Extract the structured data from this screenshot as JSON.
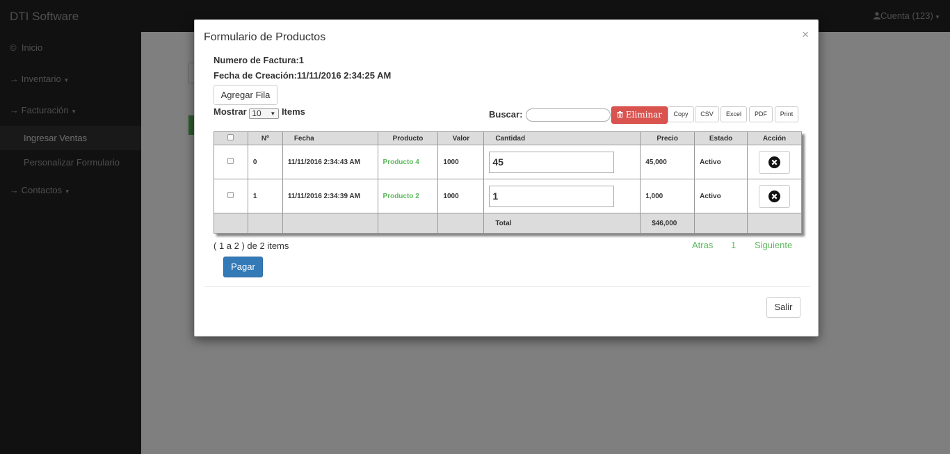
{
  "navbar": {
    "brand": "DTI Software",
    "account": "Cuenta (123)"
  },
  "sidebar": {
    "items": [
      {
        "label": "Inicio"
      },
      {
        "label": "Inventario"
      },
      {
        "label": "Facturación"
      },
      {
        "label": "Ingresar Ventas"
      },
      {
        "label": "Personalizar Formulario"
      },
      {
        "label": "Contactos"
      }
    ]
  },
  "modal": {
    "title": "Formulario de Productos",
    "close": "×",
    "invoice": "Numero de Factura:1",
    "created": "Fecha de Creación:11/11/2016 2:34:25 AM",
    "add_row": "Agregar Fila",
    "show_label": "Mostrar",
    "show_value": "10",
    "items_label": "Items",
    "search_label": "Buscar:",
    "search_value": "",
    "delete_label": "Eliminar",
    "export_buttons": [
      "Copy",
      "CSV",
      "Excel",
      "PDF",
      "Print"
    ],
    "columns": [
      "Nº",
      "Fecha",
      "Producto",
      "Valor",
      "Cantidad",
      "Precio",
      "Estado",
      "Acción"
    ],
    "rows": [
      {
        "n": "0",
        "fecha": "11/11/2016 2:34:43 AM",
        "producto": "Producto 4",
        "valor": "1000",
        "cantidad": "45",
        "precio": "45,000",
        "estado": "Activo"
      },
      {
        "n": "1",
        "fecha": "11/11/2016 2:34:39 AM",
        "producto": "Producto 2",
        "valor": "1000",
        "cantidad": "1",
        "precio": "1,000",
        "estado": "Activo"
      }
    ],
    "total_label": "Total",
    "total_value": "$46,000",
    "pagination_info": "( 1 a 2 ) de 2 items",
    "prev": "Atras",
    "page": "1",
    "next": "Siguiente",
    "pay": "Pagar",
    "exit": "Salir"
  }
}
